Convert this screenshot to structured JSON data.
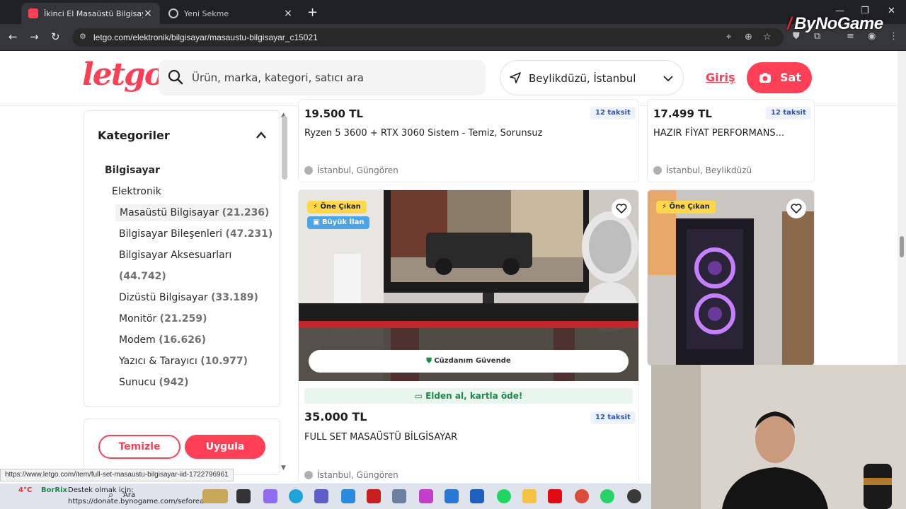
{
  "browser": {
    "tabs": [
      {
        "title": "İkinci El Masaüstü Bilgisayar İlanları",
        "active": true
      },
      {
        "title": "Yeni Sekme",
        "active": false
      }
    ],
    "url": "letgo.com/elektronik/bilgisayar/masaustu-bilgisayar_c15021",
    "watermark": "ByNoGame",
    "status_url": "https://www.letgo.com/item/full-set-masaustu-bilgisayar-iid-1722796961"
  },
  "header": {
    "logo": "letgo",
    "search_placeholder": "Ürün, marka, kategori, satıcı ara",
    "location": "Beylikdüzü, İstanbul",
    "login": "Giriş",
    "sell": "Sat"
  },
  "sidebar": {
    "title": "Kategoriler",
    "items": [
      {
        "label": "Bilgisayar",
        "count": ""
      },
      {
        "label": "Elektronik",
        "count": ""
      },
      {
        "label": "Masaüstü Bilgisayar",
        "count": "(21.236)"
      },
      {
        "label": "Bilgisayar Bileşenleri",
        "count": "(47.231)"
      },
      {
        "label": "Bilgisayar Aksesuarları",
        "count": ""
      },
      {
        "label": "",
        "count": "(44.742)"
      },
      {
        "label": "Dizüstü Bilgisayar",
        "count": "(33.189)"
      },
      {
        "label": "Monitör",
        "count": "(21.259)"
      },
      {
        "label": "Modem",
        "count": "(16.626)"
      },
      {
        "label": "Yazıcı & Tarayıcı",
        "count": "(10.977)"
      },
      {
        "label": "Sunucu",
        "count": "(942)"
      }
    ],
    "clear": "Temizle",
    "apply": "Uygula"
  },
  "listings": [
    {
      "price": "19.500 TL",
      "installments": "12 taksit",
      "title": "Ryzen 5 3600 + RTX 3060 Sistem - Temiz, Sorunsuz",
      "location": "İstanbul, Güngören"
    },
    {
      "price": "17.499 TL",
      "installments": "12 taksit",
      "title": "HAZIR FİYAT PERFORMANS...",
      "location": "İstanbul, Beylikdüzü"
    },
    {
      "price": "35.000 TL",
      "installments": "12 taksit",
      "title": "FULL SET MASAÜSTÜ BİLGİSAYAR",
      "location": "İstanbul, Güngören",
      "badges": [
        "Öne Çıkan",
        "Büyük İlan"
      ],
      "wallet": "Cüzdanım Güvende",
      "cash": "Elden al, kartla öde!"
    },
    {
      "badges": [
        "Öne Çıkan"
      ]
    }
  ],
  "taskbar": {
    "weather": "4°C",
    "streamer_name": "BorRix",
    "donate_text": "Destek olmak için:",
    "donate_url": "https://donate.bynogame.com/seforeal",
    "search": "Ara"
  },
  "colors": {
    "brand": "#ff3f55",
    "installment": "#2a54b5",
    "cash_green": "#1e8a4a",
    "badge_yellow": "#ffd84a"
  }
}
